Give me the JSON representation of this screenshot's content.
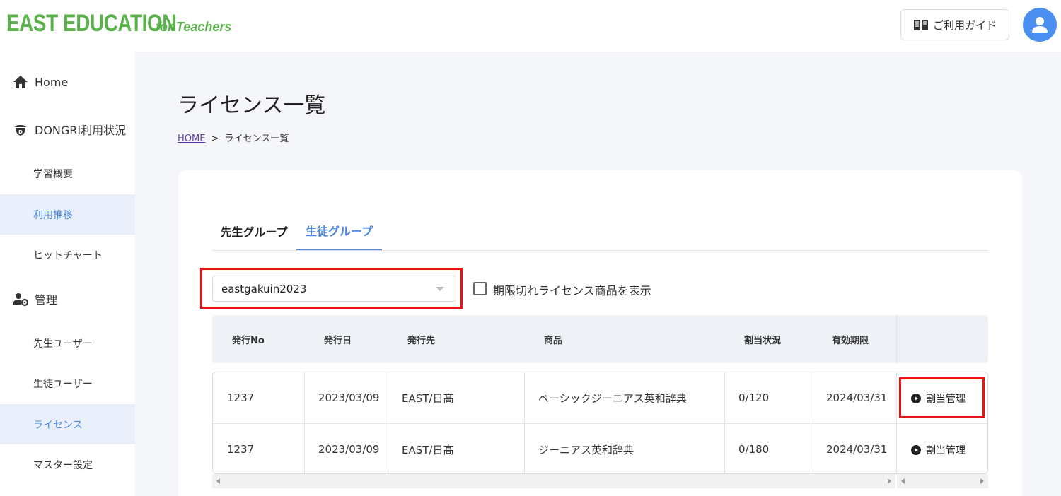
{
  "header": {
    "logo": "EAST EDUCATION",
    "logo_sub": "for Teachers",
    "guide_label": "ご利用ガイド"
  },
  "sidebar": {
    "items": [
      {
        "label": "Home",
        "icon": "home-icon"
      },
      {
        "label": "DONGRI利用状況",
        "icon": "acorn-icon"
      },
      {
        "label": "学習概要"
      },
      {
        "label": "利用推移",
        "active": true
      },
      {
        "label": "ヒットチャート"
      },
      {
        "label": "管理",
        "icon": "user-gear-icon"
      },
      {
        "label": "先生ユーザー"
      },
      {
        "label": "生徒ユーザー"
      },
      {
        "label": "ライセンス",
        "active": true
      },
      {
        "label": "マスター設定"
      }
    ]
  },
  "main": {
    "title": "ライセンス一覧",
    "breadcrumb": {
      "home": "HOME",
      "separator": ">",
      "current": "ライセンス一覧"
    },
    "tabs": [
      {
        "label": "先生グループ",
        "active": false
      },
      {
        "label": "生徒グループ",
        "active": true
      }
    ],
    "group_select": {
      "value": "eastgakuin2023"
    },
    "expired_checkbox": {
      "label": "期限切れライセンス商品を表示",
      "checked": false
    },
    "table": {
      "headers": [
        "発行No",
        "発行日",
        "発行先",
        "商品",
        "割当状況",
        "有効期限"
      ],
      "rows": [
        {
          "no": "1237",
          "date": "2023/03/09",
          "dest": "EAST/日髙",
          "product": "ベーシックジーニアス英和辞典",
          "status": "0/120",
          "expiry": "2024/03/31",
          "action": "割当管理"
        },
        {
          "no": "1237",
          "date": "2023/03/09",
          "dest": "EAST/日髙",
          "product": "ジーニアス英和辞典",
          "status": "0/180",
          "expiry": "2024/03/31",
          "action": "割当管理"
        }
      ]
    }
  },
  "colors": {
    "brand_green": "#5ab14a",
    "accent_blue": "#4a86e0",
    "highlight_red": "#e11111"
  }
}
